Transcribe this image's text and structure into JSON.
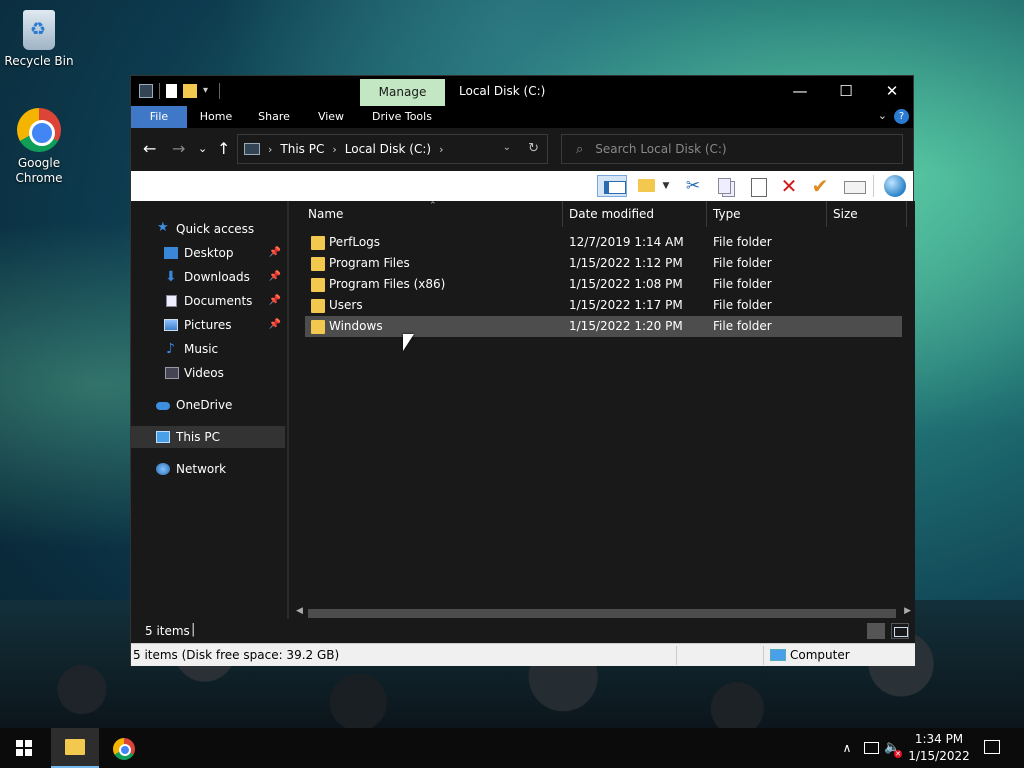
{
  "desktop": {
    "icons": [
      {
        "label": "Recycle Bin",
        "icon": "recycle-bin-icon"
      },
      {
        "label": "Google Chrome",
        "icon": "chrome-icon"
      }
    ]
  },
  "window": {
    "title": "Local Disk (C:)",
    "context_tab": "Manage",
    "controls": {
      "minimize": "—",
      "maximize": "☐",
      "close": "✕"
    },
    "ribbon_tabs": [
      "File",
      "Home",
      "Share",
      "View",
      "Drive Tools"
    ],
    "help": "?"
  },
  "navbar": {
    "back": "←",
    "forward": "→",
    "recent": "⌄",
    "up": "↑",
    "breadcrumb": [
      "This PC",
      "Local Disk (C:)"
    ],
    "search_placeholder": "Search Local Disk (C:)"
  },
  "nav_pane": {
    "quick_access": "Quick access",
    "pinned": [
      {
        "label": "Desktop",
        "pinned": true
      },
      {
        "label": "Downloads",
        "pinned": true
      },
      {
        "label": "Documents",
        "pinned": true
      },
      {
        "label": "Pictures",
        "pinned": true
      },
      {
        "label": "Music",
        "pinned": false
      },
      {
        "label": "Videos",
        "pinned": false
      }
    ],
    "onedrive": "OneDrive",
    "this_pc": "This PC",
    "network": "Network"
  },
  "file_list": {
    "columns": {
      "name": "Name",
      "date": "Date modified",
      "type": "Type",
      "size": "Size"
    },
    "rows": [
      {
        "name": "PerfLogs",
        "date": "12/7/2019 1:14 AM",
        "type": "File folder",
        "selected": false
      },
      {
        "name": "Program Files",
        "date": "1/15/2022 1:12 PM",
        "type": "File folder",
        "selected": false
      },
      {
        "name": "Program Files (x86)",
        "date": "1/15/2022 1:08 PM",
        "type": "File folder",
        "selected": false
      },
      {
        "name": "Users",
        "date": "1/15/2022 1:17 PM",
        "type": "File folder",
        "selected": false
      },
      {
        "name": "Windows",
        "date": "1/15/2022 1:20 PM",
        "type": "File folder",
        "selected": true
      }
    ]
  },
  "status": {
    "item_count": "5 items",
    "classic_left": "5 items (Disk free space: 39.2 GB)",
    "classic_right": "Computer"
  },
  "taskbar": {
    "time": "1:34 PM",
    "date": "1/15/2022"
  },
  "colors": {
    "file_tab": "#3e78c6",
    "manage_tab": "#c3e6c3",
    "folder": "#f3c84e",
    "selected_row": "#4d4d4d"
  }
}
